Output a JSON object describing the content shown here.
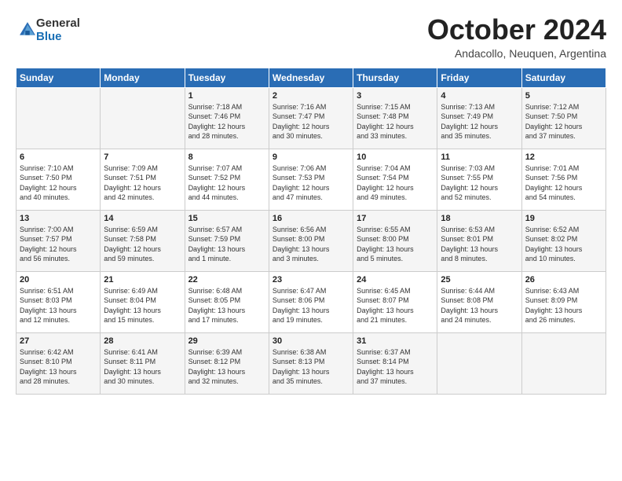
{
  "logo": {
    "general": "General",
    "blue": "Blue"
  },
  "header": {
    "month": "October 2024",
    "location": "Andacollo, Neuquen, Argentina"
  },
  "weekdays": [
    "Sunday",
    "Monday",
    "Tuesday",
    "Wednesday",
    "Thursday",
    "Friday",
    "Saturday"
  ],
  "weeks": [
    [
      {
        "day": "",
        "info": ""
      },
      {
        "day": "",
        "info": ""
      },
      {
        "day": "1",
        "info": "Sunrise: 7:18 AM\nSunset: 7:46 PM\nDaylight: 12 hours\nand 28 minutes."
      },
      {
        "day": "2",
        "info": "Sunrise: 7:16 AM\nSunset: 7:47 PM\nDaylight: 12 hours\nand 30 minutes."
      },
      {
        "day": "3",
        "info": "Sunrise: 7:15 AM\nSunset: 7:48 PM\nDaylight: 12 hours\nand 33 minutes."
      },
      {
        "day": "4",
        "info": "Sunrise: 7:13 AM\nSunset: 7:49 PM\nDaylight: 12 hours\nand 35 minutes."
      },
      {
        "day": "5",
        "info": "Sunrise: 7:12 AM\nSunset: 7:50 PM\nDaylight: 12 hours\nand 37 minutes."
      }
    ],
    [
      {
        "day": "6",
        "info": "Sunrise: 7:10 AM\nSunset: 7:50 PM\nDaylight: 12 hours\nand 40 minutes."
      },
      {
        "day": "7",
        "info": "Sunrise: 7:09 AM\nSunset: 7:51 PM\nDaylight: 12 hours\nand 42 minutes."
      },
      {
        "day": "8",
        "info": "Sunrise: 7:07 AM\nSunset: 7:52 PM\nDaylight: 12 hours\nand 44 minutes."
      },
      {
        "day": "9",
        "info": "Sunrise: 7:06 AM\nSunset: 7:53 PM\nDaylight: 12 hours\nand 47 minutes."
      },
      {
        "day": "10",
        "info": "Sunrise: 7:04 AM\nSunset: 7:54 PM\nDaylight: 12 hours\nand 49 minutes."
      },
      {
        "day": "11",
        "info": "Sunrise: 7:03 AM\nSunset: 7:55 PM\nDaylight: 12 hours\nand 52 minutes."
      },
      {
        "day": "12",
        "info": "Sunrise: 7:01 AM\nSunset: 7:56 PM\nDaylight: 12 hours\nand 54 minutes."
      }
    ],
    [
      {
        "day": "13",
        "info": "Sunrise: 7:00 AM\nSunset: 7:57 PM\nDaylight: 12 hours\nand 56 minutes."
      },
      {
        "day": "14",
        "info": "Sunrise: 6:59 AM\nSunset: 7:58 PM\nDaylight: 12 hours\nand 59 minutes."
      },
      {
        "day": "15",
        "info": "Sunrise: 6:57 AM\nSunset: 7:59 PM\nDaylight: 13 hours\nand 1 minute."
      },
      {
        "day": "16",
        "info": "Sunrise: 6:56 AM\nSunset: 8:00 PM\nDaylight: 13 hours\nand 3 minutes."
      },
      {
        "day": "17",
        "info": "Sunrise: 6:55 AM\nSunset: 8:00 PM\nDaylight: 13 hours\nand 5 minutes."
      },
      {
        "day": "18",
        "info": "Sunrise: 6:53 AM\nSunset: 8:01 PM\nDaylight: 13 hours\nand 8 minutes."
      },
      {
        "day": "19",
        "info": "Sunrise: 6:52 AM\nSunset: 8:02 PM\nDaylight: 13 hours\nand 10 minutes."
      }
    ],
    [
      {
        "day": "20",
        "info": "Sunrise: 6:51 AM\nSunset: 8:03 PM\nDaylight: 13 hours\nand 12 minutes."
      },
      {
        "day": "21",
        "info": "Sunrise: 6:49 AM\nSunset: 8:04 PM\nDaylight: 13 hours\nand 15 minutes."
      },
      {
        "day": "22",
        "info": "Sunrise: 6:48 AM\nSunset: 8:05 PM\nDaylight: 13 hours\nand 17 minutes."
      },
      {
        "day": "23",
        "info": "Sunrise: 6:47 AM\nSunset: 8:06 PM\nDaylight: 13 hours\nand 19 minutes."
      },
      {
        "day": "24",
        "info": "Sunrise: 6:45 AM\nSunset: 8:07 PM\nDaylight: 13 hours\nand 21 minutes."
      },
      {
        "day": "25",
        "info": "Sunrise: 6:44 AM\nSunset: 8:08 PM\nDaylight: 13 hours\nand 24 minutes."
      },
      {
        "day": "26",
        "info": "Sunrise: 6:43 AM\nSunset: 8:09 PM\nDaylight: 13 hours\nand 26 minutes."
      }
    ],
    [
      {
        "day": "27",
        "info": "Sunrise: 6:42 AM\nSunset: 8:10 PM\nDaylight: 13 hours\nand 28 minutes."
      },
      {
        "day": "28",
        "info": "Sunrise: 6:41 AM\nSunset: 8:11 PM\nDaylight: 13 hours\nand 30 minutes."
      },
      {
        "day": "29",
        "info": "Sunrise: 6:39 AM\nSunset: 8:12 PM\nDaylight: 13 hours\nand 32 minutes."
      },
      {
        "day": "30",
        "info": "Sunrise: 6:38 AM\nSunset: 8:13 PM\nDaylight: 13 hours\nand 35 minutes."
      },
      {
        "day": "31",
        "info": "Sunrise: 6:37 AM\nSunset: 8:14 PM\nDaylight: 13 hours\nand 37 minutes."
      },
      {
        "day": "",
        "info": ""
      },
      {
        "day": "",
        "info": ""
      }
    ]
  ]
}
